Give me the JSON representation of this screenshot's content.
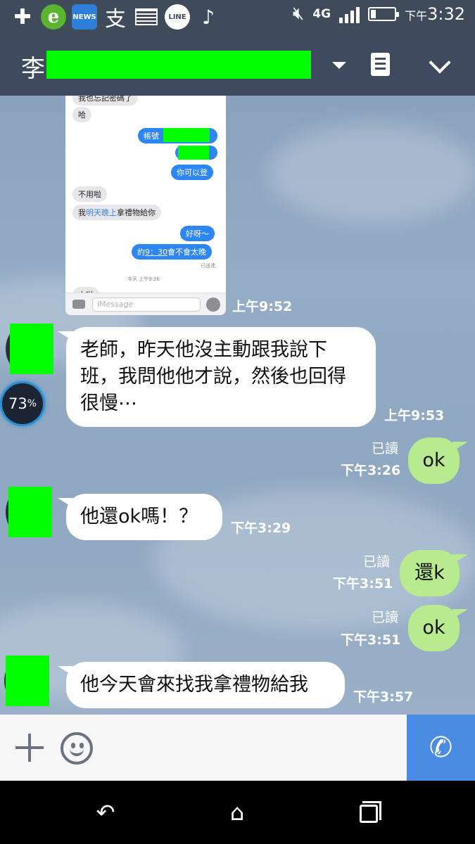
{
  "status_bar": {
    "time_prefix": "下午",
    "time": "3:32",
    "network": "4G",
    "app_icons": [
      "add-icon",
      "browser-icon",
      "news-icon",
      "alipay-icon",
      "gallery-icon",
      "line-icon",
      "music-icon"
    ],
    "news_label": "NEWS",
    "line_label": "LINE",
    "zhi_label": "支"
  },
  "header": {
    "contact_name": "李"
  },
  "screenshot": {
    "messages": [
      {
        "dir": "in",
        "text": "我也忘記密碼了"
      },
      {
        "dir": "in",
        "text": "哈"
      },
      {
        "dir": "out",
        "text": "帳號"
      },
      {
        "dir": "out",
        "text": "你可以登"
      },
      {
        "dir": "in",
        "text": "不用啦"
      },
      {
        "dir": "in",
        "text_prefix": "我",
        "text_link": "明天晚上",
        "text_suffix": "拿禮物給你"
      },
      {
        "dir": "out",
        "text": "好呀～"
      },
      {
        "dir": "out",
        "text_prefix": "約",
        "text_link": "9：30",
        "text_suffix": "會不會太晚"
      }
    ],
    "delivered": "已送達",
    "today_stamp": "今天 上午9:26",
    "input_placeholder": "iMessage",
    "partial_message": "大啦"
  },
  "chat": {
    "messages": [
      {
        "dir": "in",
        "text": "老師，昨天他沒主動跟我說下班，我問他他才說，然後也回得很慢⋯",
        "time": "上午9:53"
      },
      {
        "dir": "out",
        "text": "ok",
        "read": "已讀",
        "time": "下午3:26"
      },
      {
        "dir": "in",
        "text": "他還ok嗎！？",
        "time": "下午3:29"
      },
      {
        "dir": "out",
        "text": "還k",
        "read": "已讀",
        "time": "下午3:51"
      },
      {
        "dir": "out",
        "text": "ok",
        "read": "已讀",
        "time": "下午3:51"
      },
      {
        "dir": "in",
        "text": "他今天會來找我拿禮物給我",
        "time": "下午3:57"
      }
    ],
    "image_time": "上午9:52",
    "battery_overlay": "73",
    "battery_overlay_unit": "%"
  },
  "input_bar": {
    "plus_icon": "plus-icon",
    "emoji_icon": "emoji-icon",
    "call_icon": "phone-icon",
    "call_glyph": "✆"
  },
  "nav": {
    "back_glyph": "↶",
    "home_glyph": "⌂"
  },
  "colors": {
    "header_bg": "#3e4b5e",
    "outgoing_bubble": "#b8eb8f",
    "incoming_bubble": "#ffffff",
    "call_button": "#4a8be4",
    "redaction": "#00ff00"
  }
}
